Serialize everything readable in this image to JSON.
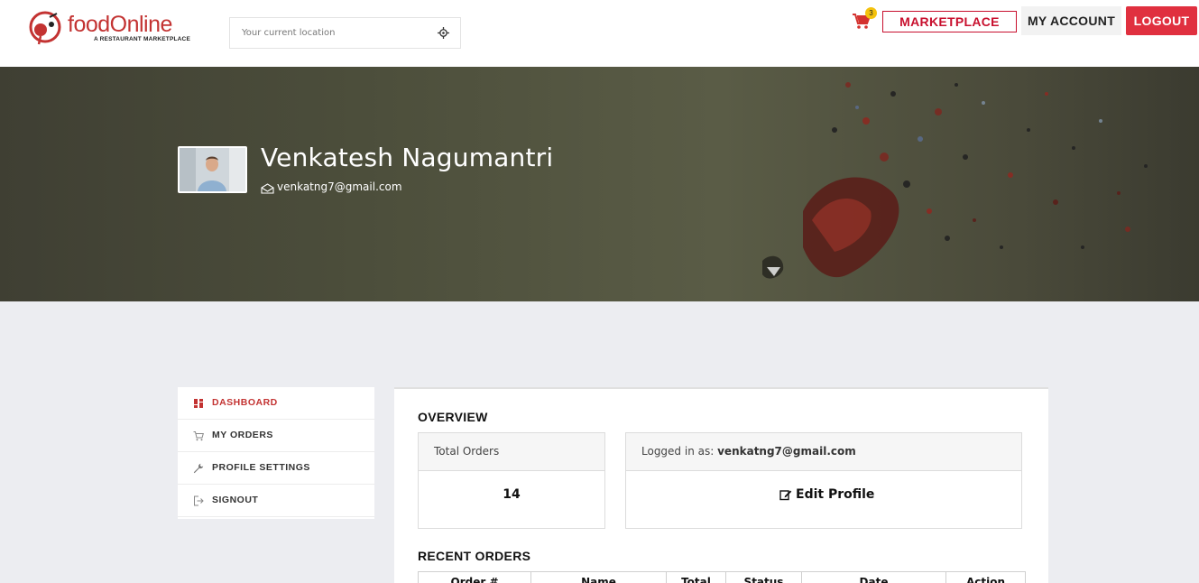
{
  "header": {
    "logo_text": "foodOnline",
    "logo_tagline": "A RESTAURANT MARKETPLACE",
    "location_placeholder": "Your current location",
    "cart_count": "3",
    "marketplace_label": "MARKETPLACE",
    "account_label": "MY ACCOUNT",
    "logout_label": "LOGOUT"
  },
  "profile": {
    "name": "Venkatesh Nagumantri",
    "email": "venkatng7@gmail.com"
  },
  "sidebar": {
    "items": [
      {
        "label": "DASHBOARD",
        "icon": "dashboard-icon",
        "active": true
      },
      {
        "label": "MY ORDERS",
        "icon": "cart-icon",
        "active": false
      },
      {
        "label": "PROFILE SETTINGS",
        "icon": "wrench-icon",
        "active": false
      },
      {
        "label": "SIGNOUT",
        "icon": "signout-icon",
        "active": false
      }
    ]
  },
  "overview": {
    "title": "OVERVIEW",
    "total_orders_label": "Total Orders",
    "total_orders_value": "14",
    "logged_in_label": "Logged in as:",
    "logged_in_email": "venkatng7@gmail.com",
    "edit_profile_label": "Edit Profile"
  },
  "recent_orders": {
    "title": "RECENT ORDERS",
    "columns": [
      "Order #",
      "Name",
      "Total",
      "Status",
      "Date",
      "Action"
    ]
  },
  "colors": {
    "brand_red": "#c33332",
    "logout_bg": "#e0303f",
    "badge_yellow": "#f4c20d"
  }
}
